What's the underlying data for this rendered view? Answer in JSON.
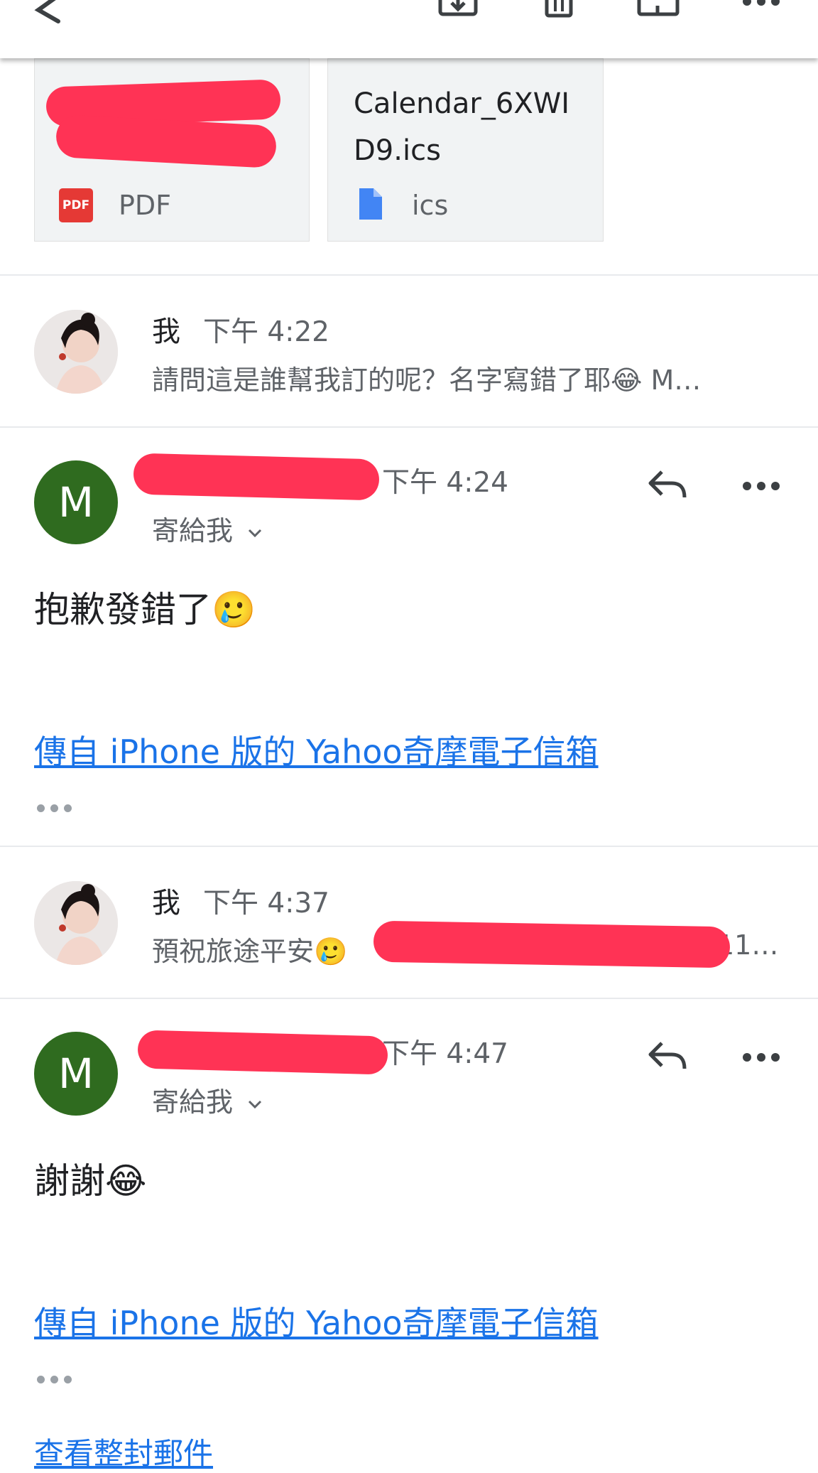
{
  "toolbar": {
    "back_icon": "back-arrow-icon",
    "icons": [
      "archive-icon",
      "trash-icon",
      "mark-unread-icon",
      "more-icon"
    ]
  },
  "attachments": [
    {
      "name": "",
      "type": "PDF",
      "badge": "PDF"
    },
    {
      "name": "Calendar_6XWID9.ics",
      "type": "ics"
    }
  ],
  "messages": [
    {
      "sender": "我",
      "time": "下午 4:22",
      "snippet": "請問這是誰幫我訂的呢？名字寫錯了耶😂 M…"
    },
    {
      "avatar_letter": "M",
      "time": "下午 4:24",
      "to": "寄給我",
      "body": "抱歉發錯了🥲",
      "signature": "傳自 iPhone 版的 Yahoo奇摩電子信箱"
    },
    {
      "sender": "我",
      "time": "下午 4:37",
      "snippet": "預祝旅途平安🥲",
      "snippet_tail": "11…"
    },
    {
      "avatar_letter": "M",
      "time": "下午 4:47",
      "to": "寄給我",
      "body": "謝謝😂",
      "signature": "傳自 iPhone 版的 Yahoo奇摩電子信箱"
    }
  ],
  "footer": {
    "view_full_label": "查看整封郵件"
  },
  "colors": {
    "redaction": "#ff3355",
    "avatar_m": "#2f6b1f",
    "link": "#1a73e8",
    "pdf": "#e53935"
  }
}
